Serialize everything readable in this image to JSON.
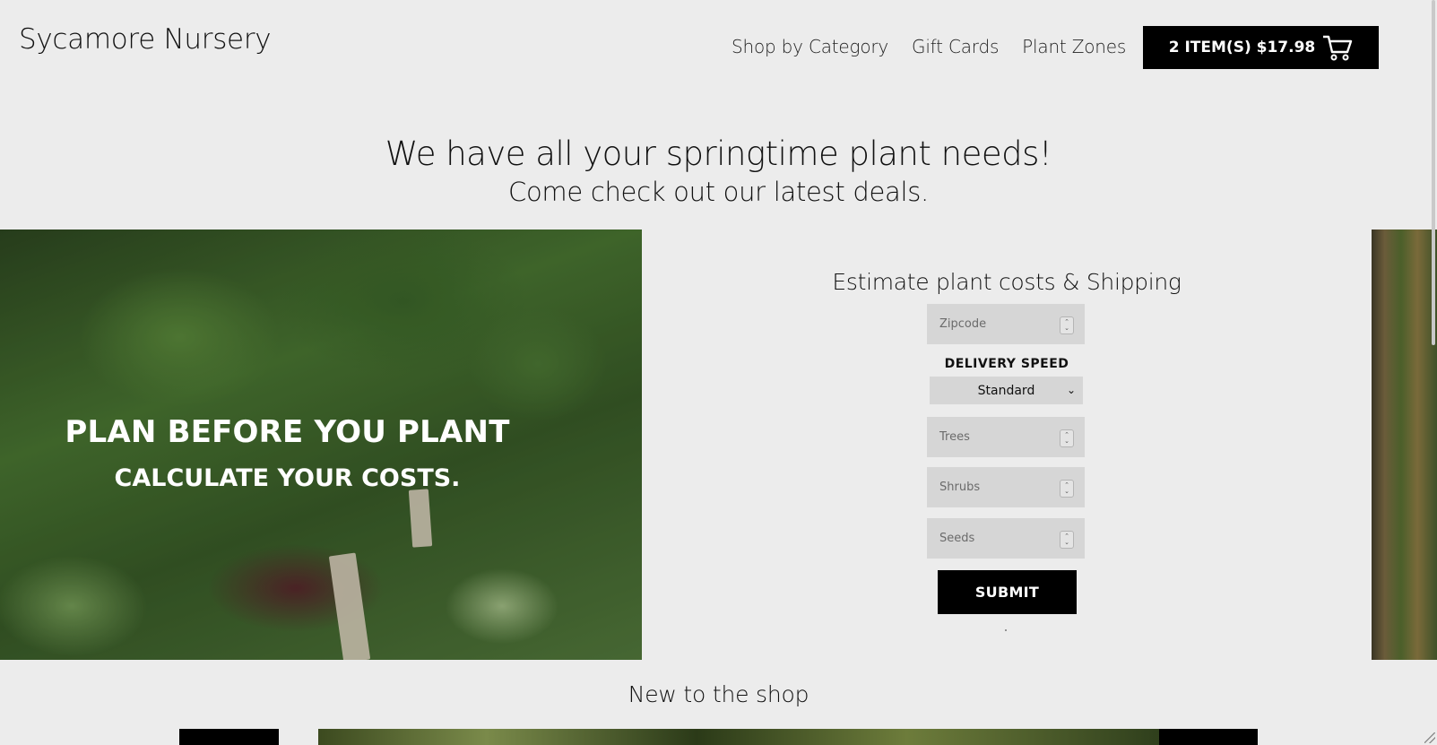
{
  "header": {
    "brand": "Sycamore Nursery",
    "nav": [
      "Shop by Category",
      "Gift Cards",
      "Plant Zones"
    ],
    "cart_label": "2 ITEM(S) $17.98"
  },
  "hero": {
    "title": "We have all your springtime plant needs!",
    "subtitle": "Come check out our latest deals."
  },
  "plan_banner": {
    "heading": "PLAN BEFORE YOU PLANT",
    "subheading": "CALCULATE YOUR COSTS."
  },
  "estimator": {
    "title": "Estimate plant costs & Shipping",
    "zipcode_placeholder": "Zipcode",
    "delivery_label": "DELIVERY SPEED",
    "delivery_selected": "Standard",
    "trees_placeholder": "Trees",
    "shrubs_placeholder": "Shrubs",
    "seeds_placeholder": "Seeds",
    "submit_label": "SUBMIT"
  },
  "new_section": {
    "title": "New to the shop"
  },
  "colors": {
    "background": "#ececec",
    "button": "#000000",
    "field": "#d6d6d6"
  },
  "icons": {
    "cart": "shopping-cart-icon",
    "spinner": "number-spinner-icon",
    "select": "chevron-down-icon"
  }
}
